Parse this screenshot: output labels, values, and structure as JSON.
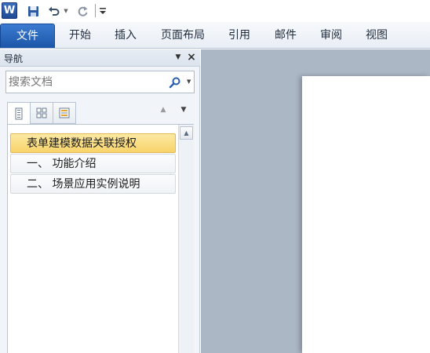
{
  "qat": {
    "app_icon_letter": "W",
    "icons": [
      "word-logo-icon",
      "save-icon",
      "undo-icon",
      "redo-icon",
      "customize-qat-icon"
    ]
  },
  "ribbon": {
    "tabs": [
      {
        "label": "文件"
      },
      {
        "label": "开始"
      },
      {
        "label": "插入"
      },
      {
        "label": "页面布局"
      },
      {
        "label": "引用"
      },
      {
        "label": "邮件"
      },
      {
        "label": "审阅"
      },
      {
        "label": "视图"
      }
    ],
    "file_tab_color": "#2a66b8"
  },
  "nav_pane": {
    "title": "导航",
    "search_placeholder": "搜索文档",
    "view_tabs": [
      "headings-view-icon",
      "pages-view-icon",
      "results-view-icon"
    ],
    "headings": [
      {
        "label": "表单建模数据关联授权",
        "selected": true
      },
      {
        "label": "一、 功能介绍",
        "selected": false
      },
      {
        "label": "二、 场景应用实例说明",
        "selected": false
      }
    ],
    "selected_color": "#f9dc7e"
  },
  "document": {
    "background": "#acb7c6"
  }
}
